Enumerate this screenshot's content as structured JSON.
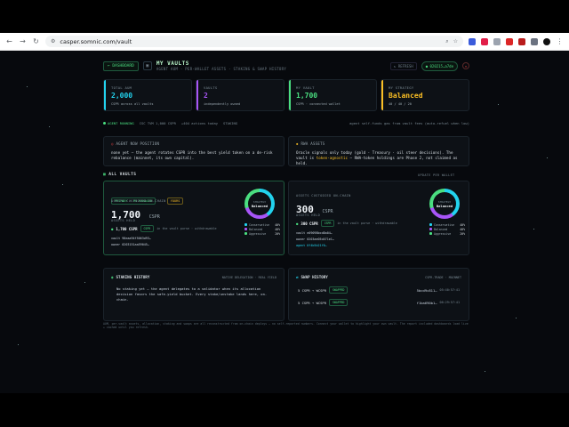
{
  "browser": {
    "url": "casper.somnic.com/vault"
  },
  "header": {
    "dashboard_label": "← DASHBOARD",
    "title": "MY VAULTS",
    "subtitle": "AGENT AUM · PER-WALLET ASSETS · STAKING & SWAP HISTORY",
    "refresh_label": "↻ REFRESH",
    "account_label": "● 020215…a7de"
  },
  "stats": [
    {
      "label": "TOTAL AUM",
      "value": "2,000",
      "desc": "CSPR across all vaults",
      "color": "#22d3ee"
    },
    {
      "label": "VAULTS",
      "value": "2",
      "desc": "independently owned",
      "color": "#a855f7"
    },
    {
      "label": "MY VAULT",
      "value": "1,700",
      "desc": "CSPR · connected wallet",
      "color": "#4ade80"
    },
    {
      "label": "MY STRATEGY",
      "value": "Balanced",
      "desc": "40 / 40 / 20",
      "color": "#fbbf24"
    }
  ],
  "status": {
    "agent": "AGENT RUNNING",
    "net": "CSC TVM 1,000 CSPR",
    "actions": "+404 actions today",
    "staking": "STAKING",
    "right": "agent self-funds gas from vault fees (auto-refuel when low)"
  },
  "agent_position": {
    "heading": "AGENT NOW POSITION",
    "body": "none yet — the agent rotates CSPR into the best yield token on a de-risk rebalance (mainnet, its own capital)."
  },
  "rwa": {
    "heading": "RWA ASSETS",
    "body_a": "Oracle signals only today (gold · Treasury · oil steer decisions). The vault is ",
    "body_hl": "token-agnostic",
    "body_b": " — RWA-token holdings are Phase 2, not claimed as held."
  },
  "vaults_section": {
    "title": "ALL VAULTS",
    "right": "UPDATE PER WALLET"
  },
  "vault_a": {
    "tags": [
      "PRIMARY · MY MANAGED",
      "YOURS"
    ],
    "label": "ASSETS CUSTODIED ON-CHAIN",
    "amount": "1,700",
    "unit": "CSPR",
    "held_label": "ASSETS HELD",
    "held_amount": "1,700 CSPR",
    "held_chip": "CSPR",
    "held_note": "in the vault purse · withdrawable",
    "vault_line": "vault 98eaa94f5063d93…",
    "owner_line": "owner 0203151aa59045…",
    "ring_t1": "STRATEGY",
    "ring_t2": "Balanced",
    "legend": [
      {
        "name": "Conservative",
        "pct": "40%",
        "color": "#22d3ee"
      },
      {
        "name": "Balanced",
        "pct": "40%",
        "color": "#a855f7"
      },
      {
        "name": "Aggressive",
        "pct": "20%",
        "color": "#4ade80"
      }
    ]
  },
  "vault_b": {
    "label": "ASSETS CUSTODIED ON-CHAIN",
    "amount": "300",
    "unit": "CSPR",
    "held_label": "ASSETS HELD",
    "held_amount": "300 CSPR",
    "held_chip": "CSPR",
    "held_note": "in the vault purse · withdrawable",
    "vault_line": "vault e09098bcd8a04…",
    "owner_line": "owner 0203ae05d471e1…",
    "agent_line": "agent 0f4b5b21f0…",
    "ring_t1": "STRATEGY",
    "ring_t2": "Balanced",
    "legend": [
      {
        "name": "Conservative",
        "pct": "40%",
        "color": "#22d3ee"
      },
      {
        "name": "Balanced",
        "pct": "40%",
        "color": "#a855f7"
      },
      {
        "name": "Aggressive",
        "pct": "20%",
        "color": "#4ade80"
      }
    ]
  },
  "staking": {
    "title": "STAKING HISTORY",
    "right": "NATIVE DELEGATION · REAL YIELD",
    "body": "No staking yet — the agent delegates to a validator when its allocation decision favors the safe-yield bucket. Every stake/unstake lands here, on-chain."
  },
  "swap": {
    "title": "SWAP HISTORY",
    "right": "CSPR.TRADE · MAINNET",
    "rows": [
      {
        "amt": "5 CSPR → WCSPR",
        "chip": "SWAPPED",
        "hash": "5bcd9c811…",
        "time": "05:40:57:41"
      },
      {
        "amt": "5 CSPR → WCSPR",
        "chip": "SWAPPED",
        "hash": "f1ba690b1…",
        "time": "06:29:57:41"
      }
    ]
  },
  "footer": "AUM, per-vault assets, allocation, staking and swaps are all reconstructed from on-chain deploys — no self-reported numbers. Connect your wallet to highlight your own vault. The report included dashboards load live + cached until you refresh."
}
